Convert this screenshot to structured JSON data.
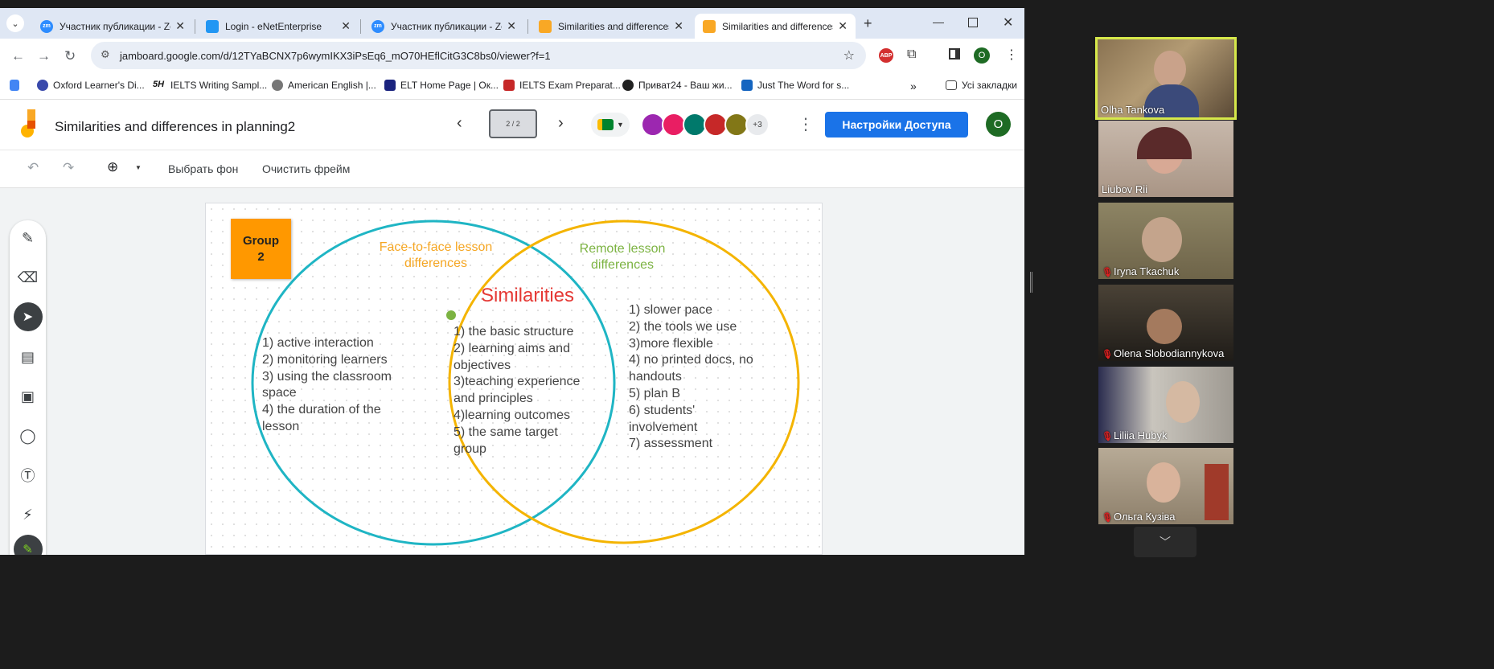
{
  "tabs": [
    {
      "title": "Участник публикации - Zo",
      "icon": "zoom-icon",
      "color": "#2d8cff",
      "active": false
    },
    {
      "title": "Login - eNetEnterprise",
      "icon": "enet-icon",
      "color": "#2196f3",
      "active": false
    },
    {
      "title": "Участник публикации - Zo",
      "icon": "zoom-icon",
      "color": "#2d8cff",
      "active": false
    },
    {
      "title": "Similarities and differences",
      "icon": "jamboard-icon",
      "color": "#f9a825",
      "active": false
    },
    {
      "title": "Similarities and differences",
      "icon": "jamboard-icon",
      "color": "#f9a825",
      "active": true
    }
  ],
  "url": "jamboard.google.com/d/12TYaBCNX7p6wymIKX3iPsEq6_mO70HEflCitG3C8bs0/viewer?f=1",
  "bookmarks": [
    {
      "label": "Oxford Learner's Di...",
      "color": "#3949ab"
    },
    {
      "label": "IELTS Writing Sampl...",
      "color": "#111"
    },
    {
      "label": "American English |...",
      "color": "#777"
    },
    {
      "label": "ELT Home Page | Ок...",
      "color": "#1a237e"
    },
    {
      "label": "IELTS Exam Preparat...",
      "color": "#c62828"
    },
    {
      "label": "Приват24 - Ваш жи...",
      "color": "#222"
    },
    {
      "label": "Just The Word for s...",
      "color": "#1565c0"
    }
  ],
  "bookmarks_folder": "Усі закладки",
  "jam": {
    "title": "Similarities and differences in planning2",
    "frame": "2 / 2",
    "extra_collaborators": "+3",
    "share_label": "Настройки Доступа",
    "user_initial": "O",
    "bg_label": "Выбрать фон",
    "clear_label": "Очистить фрейм"
  },
  "board": {
    "group": "Group\n2",
    "face_title": "Face-to-face lesson\ndifferences",
    "remote_title": "Remote lesson\ndifferences",
    "sim_title": "Similarities",
    "face_list": "1) active interaction\n2) monitoring learners\n3) using the classroom\nspace\n4) the duration of the\nlesson",
    "sim_list": "1) the basic structure\n2) learning aims and\nobjectives\n3)teaching experience\nand principles\n4)learning outcomes\n5) the same target\ngroup",
    "remote_list": "1) slower pace\n2) the tools we use\n3)more flexible\n4) no printed docs, no\nhandouts\n5) plan B\n6) students'\ninvolvement\n7) assessment",
    "colors": {
      "face": "#f5a623",
      "remote": "#7cb342",
      "sim": "#e53935",
      "circle_left": "#1fb5c4",
      "circle_right": "#f4b400"
    }
  },
  "participants": [
    {
      "name": "Olha Tankova",
      "muted": false,
      "active": true,
      "bg": "#6b5a3f"
    },
    {
      "name": "Liubov Rii",
      "muted": false,
      "active": false,
      "bg": "#b9a89a"
    },
    {
      "name": "Iryna Tkachuk",
      "muted": true,
      "active": false,
      "bg": "#7c7458"
    },
    {
      "name": "Olena Slobodiannykova",
      "muted": true,
      "active": false,
      "bg": "#2e2a24"
    },
    {
      "name": "Liliia Hubyk",
      "muted": true,
      "active": false,
      "bg": "#8f8b85"
    },
    {
      "name": "Ольга Кузіва",
      "muted": true,
      "active": false,
      "bg": "#9c8e7a"
    }
  ]
}
